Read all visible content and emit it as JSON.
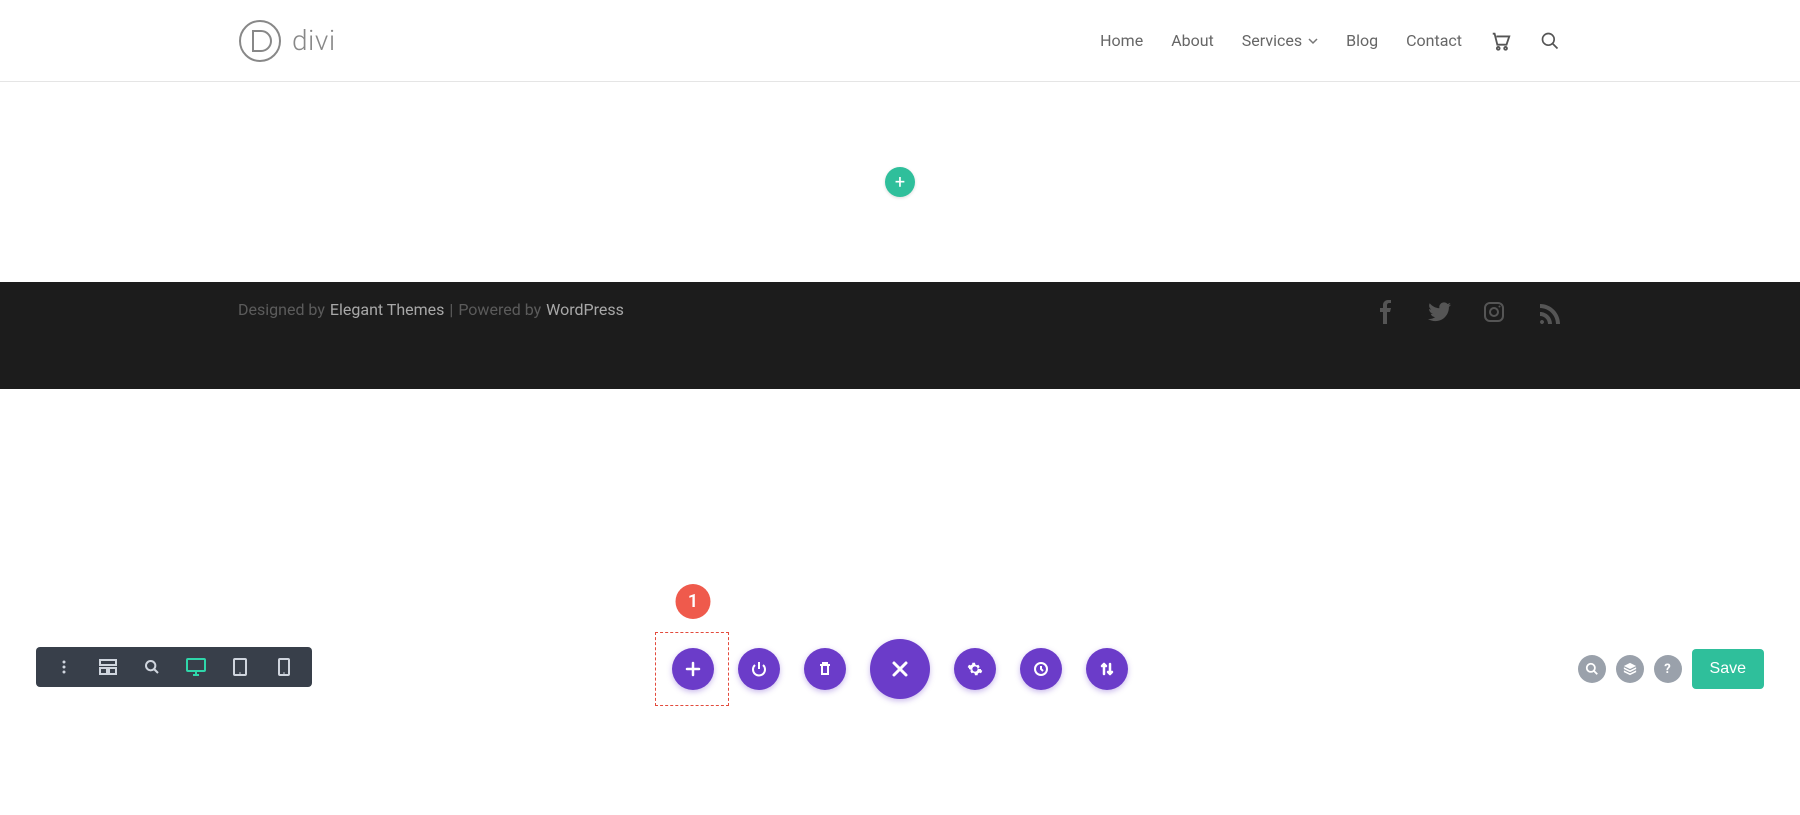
{
  "brand": {
    "name": "divi"
  },
  "nav": {
    "home": "Home",
    "about": "About",
    "services": "Services",
    "blog": "Blog",
    "contact": "Contact"
  },
  "canvas": {
    "add_section_glyph": "+"
  },
  "footer": {
    "prefix": "Designed by ",
    "themes": "Elegant Themes",
    "sep": " | ",
    "mid": "Powered by ",
    "wp": "WordPress"
  },
  "builder": {
    "badge": "1",
    "save_label": "Save",
    "help_glyph": "?"
  },
  "colors": {
    "accent_teal": "#2fbf9b",
    "accent_purple": "#6b3cc9",
    "badge_red": "#ef5a4c",
    "toolbar_bg": "#383f4a"
  }
}
